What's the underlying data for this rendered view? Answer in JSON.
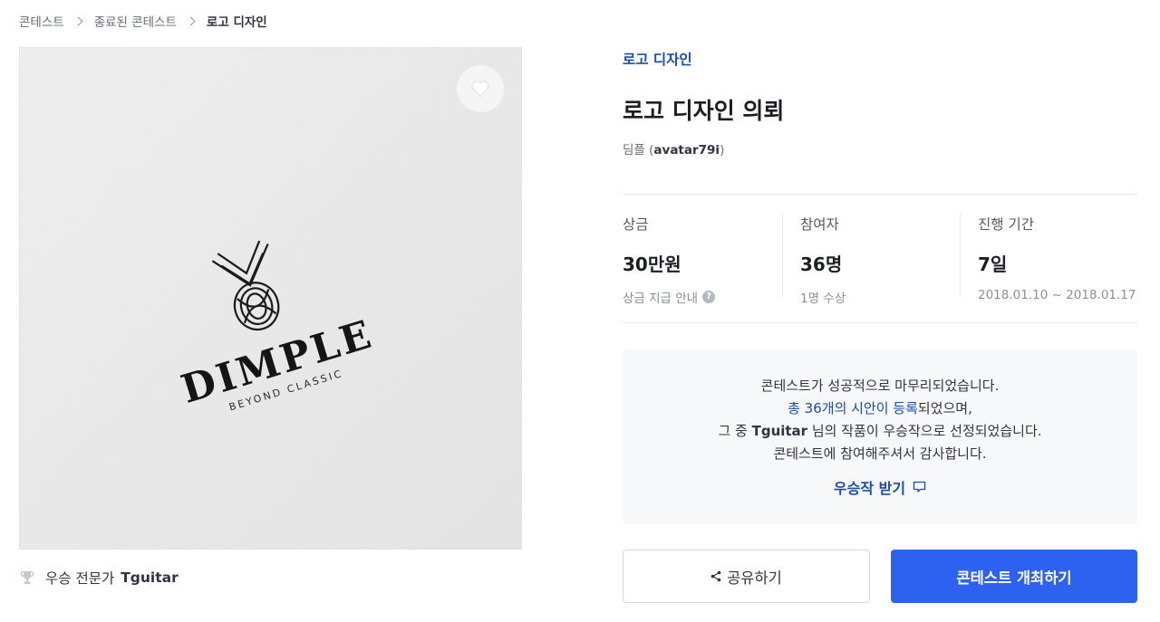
{
  "breadcrumb": {
    "items": [
      "콘테스트",
      "종료된 콘테스트",
      "로고 디자인"
    ]
  },
  "image": {
    "logo_main": "DIMPLE",
    "logo_sub": "BEYOND CLASSIC"
  },
  "winner": {
    "label": "우승 전문가",
    "name": "Tguitar"
  },
  "contest": {
    "category": "로고 디자인",
    "title": "로고 디자인 의뢰",
    "client_name": "딤플",
    "client_id": "avatar79i"
  },
  "stats": {
    "prize": {
      "label": "상금",
      "value": "30만원",
      "sub": "상금 지급 안내"
    },
    "participants": {
      "label": "참여자",
      "value": "36명",
      "sub": "1명 수상"
    },
    "period": {
      "label": "진행 기간",
      "value": "7일",
      "sub": "2018.01.10 ~ 2018.01.17"
    }
  },
  "result": {
    "line1": "콘테스트가 성공적으로 마무리되었습니다.",
    "line2_link": "총 36개의 시안이 등록",
    "line2_rest": "되었으며,",
    "line3_prefix": "그 중 ",
    "line3_name": "Tguitar",
    "line3_rest": " 님의 작품이 우승작으로 선정되었습니다.",
    "line4": "콘테스트에 참여해주셔서 감사합니다.",
    "receive_label": "우승작 받기"
  },
  "buttons": {
    "share": "공유하기",
    "host": "콘테스트 개최하기"
  },
  "colors": {
    "accent_blue": "#1a4ea8",
    "primary_button": "#2d61f0"
  },
  "icons": [
    "chevron-right-icon",
    "heart-icon",
    "trophy-icon",
    "share-icon",
    "help-icon",
    "chat-icon"
  ]
}
